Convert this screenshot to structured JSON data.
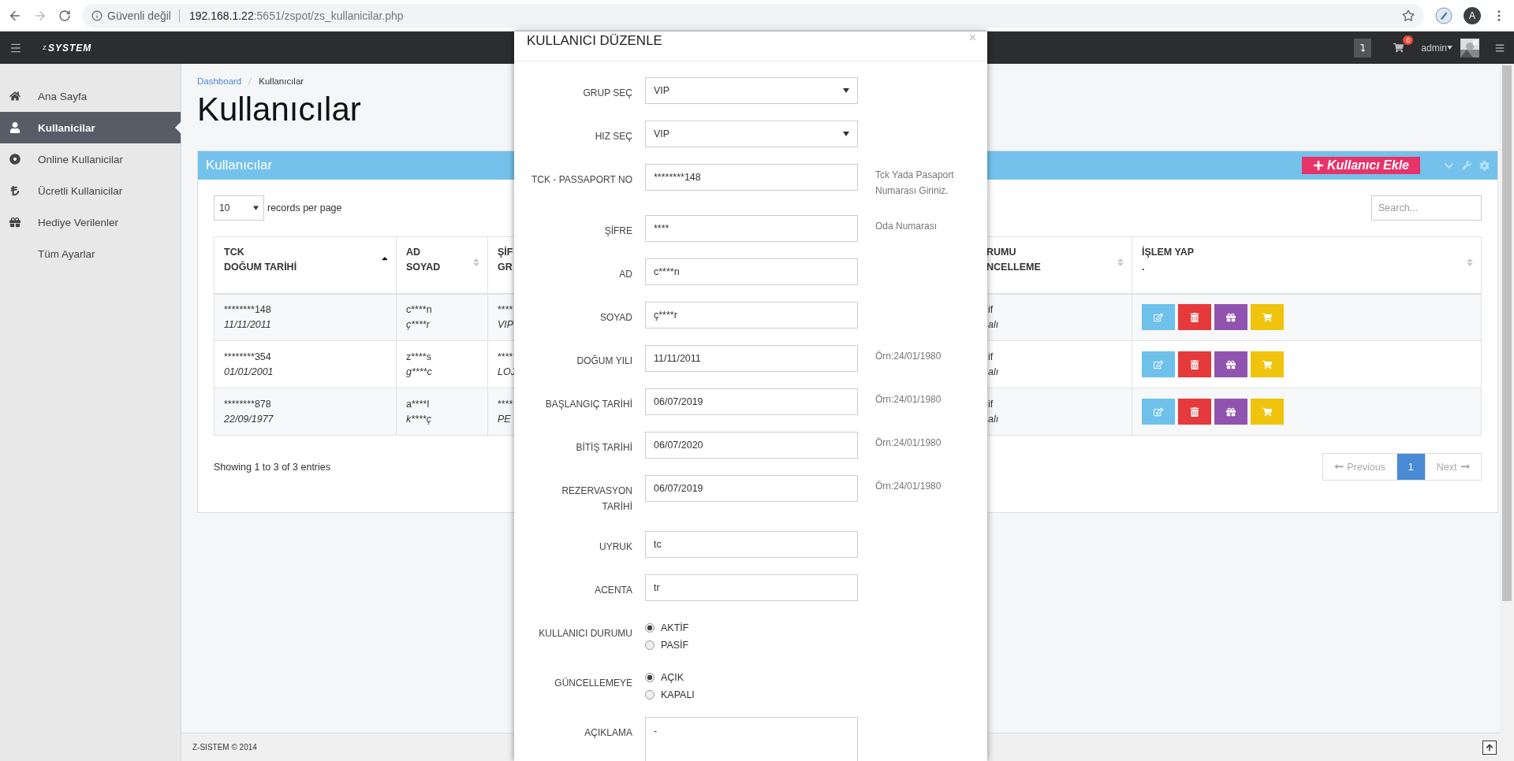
{
  "browser": {
    "security": "Güvenli değil",
    "url_host": "192.168.1.22",
    "url_rest": ":5651/zspot/zs_kullanicilar.php",
    "profile": "A"
  },
  "header": {
    "logo_mark": "Z",
    "logo": "SYSTEM",
    "cart_count": "0",
    "user": "admin"
  },
  "sidebar": {
    "items": [
      {
        "label": "Ana Sayfa",
        "kind": "home",
        "selected": false
      },
      {
        "label": "Kullanicilar",
        "kind": "user",
        "selected": true
      },
      {
        "label": "Online Kullanicilar",
        "kind": "target",
        "selected": false
      },
      {
        "label": "Ücretli Kullanicilar",
        "kind": "lira",
        "selected": false
      },
      {
        "label": "Hediye Verilenler",
        "kind": "gift",
        "selected": false
      },
      {
        "label": "Tüm Ayarlar",
        "kind": "plain",
        "selected": false
      }
    ]
  },
  "breadcrumb": [
    {
      "label": "Dashboard",
      "kind": "link"
    },
    {
      "label": "Kullanıcılar",
      "kind": "current"
    }
  ],
  "page_title": "Kullanıcılar",
  "panel": {
    "title": "Kullanıcılar",
    "add_button": "Kullanıcı Ekle"
  },
  "table_controls": {
    "page_size": "10",
    "page_size_label": "records per page",
    "search_placeholder": "Search..."
  },
  "table": {
    "columns": [
      {
        "lines": [
          "TCK",
          "DOĞUM TARİHİ"
        ],
        "kind": "asc"
      },
      {
        "lines": [
          "AD",
          "SOYAD"
        ],
        "kind": "both"
      },
      {
        "lines": [
          "ŞİF",
          "GR"
        ],
        "kind": "plain"
      },
      {
        "lines": [
          "RUMU",
          "NCELLEME"
        ],
        "kind": "both"
      },
      {
        "lines": [
          "İŞLEM YAP",
          "."
        ],
        "kind": "both"
      }
    ],
    "rows": [
      {
        "cells": [
          [
            "********148",
            "11/11/2011"
          ],
          [
            "c****n",
            "ç****r"
          ],
          [
            "****",
            "VIP"
          ],
          [
            "if",
            "alı"
          ]
        ],
        "actions": [
          {
            "kind": "edit"
          },
          {
            "kind": "delete"
          },
          {
            "kind": "gift"
          },
          {
            "kind": "cart"
          }
        ]
      },
      {
        "cells": [
          [
            "********354",
            "01/01/2001"
          ],
          [
            "z****s",
            "g****c"
          ],
          [
            "****",
            "LOJ"
          ],
          [
            "if",
            "alı"
          ]
        ],
        "actions": [
          {
            "kind": "edit"
          },
          {
            "kind": "delete"
          },
          {
            "kind": "gift"
          },
          {
            "kind": "cart"
          }
        ]
      },
      {
        "cells": [
          [
            "********878",
            "22/09/1977"
          ],
          [
            "a****l",
            "k****ç"
          ],
          [
            "****",
            "PE"
          ],
          [
            "if",
            "alı"
          ]
        ],
        "actions": [
          {
            "kind": "edit"
          },
          {
            "kind": "delete"
          },
          {
            "kind": "gift"
          },
          {
            "kind": "cart"
          }
        ]
      }
    ]
  },
  "summary": "Showing 1 to 3 of 3 entries",
  "pagination": [
    {
      "label": "Previous",
      "kind": "prev",
      "selected": false,
      "disabled": true
    },
    {
      "label": "1",
      "kind": "page",
      "selected": true,
      "disabled": false
    },
    {
      "label": "Next",
      "kind": "next",
      "selected": false,
      "disabled": true
    }
  ],
  "footer": "Z-SISTEM © 2014",
  "modal": {
    "title": "KULLANICI DÜZENLE",
    "close": "×",
    "fields": [
      {
        "label": "GRUP SEÇ",
        "kind": "select",
        "value": "VIP"
      },
      {
        "label": "HIZ SEÇ",
        "kind": "select",
        "value": "VIP"
      },
      {
        "label": "TCK - PASSAPORT NO",
        "kind": "text",
        "value": "********148",
        "help": "Tck Yada Pasaport Numarası Giriniz."
      },
      {
        "label": "ŞİFRE",
        "kind": "text",
        "value": "****",
        "help": "Oda Numarası"
      },
      {
        "label": "AD",
        "kind": "text",
        "value": "c****n"
      },
      {
        "label": "SOYAD",
        "kind": "text",
        "value": "ç****r"
      },
      {
        "label": "DOĞUM YILI",
        "kind": "text",
        "value": "11/11/2011",
        "help": "Örn:24/01/1980"
      },
      {
        "label": "BAŞLANGIÇ TARİHİ",
        "kind": "text",
        "value": "06/07/2019",
        "help": "Örn:24/01/1980"
      },
      {
        "label": "BİTİŞ TARİHİ",
        "kind": "text",
        "value": "06/07/2020",
        "help": "Örn:24/01/1980"
      },
      {
        "label": "REZERVASYON TARİHİ",
        "kind": "text",
        "value": "06/07/2019",
        "help": "Örn:24/01/1980"
      },
      {
        "label": "UYRUK",
        "kind": "text",
        "value": "tc"
      },
      {
        "label": "ACENTA",
        "kind": "text",
        "value": "tr"
      },
      {
        "label": "KULLANICI DURUMU",
        "kind": "radio",
        "options": [
          {
            "label": "AKTİF",
            "selected": true
          },
          {
            "label": "PASİF",
            "selected": false
          }
        ]
      },
      {
        "label": "GÜNCELLEMEYE",
        "kind": "radio",
        "options": [
          {
            "label": "AÇIK",
            "selected": true
          },
          {
            "label": "KAPALI",
            "selected": false
          }
        ]
      },
      {
        "label": "AÇIKLAMA",
        "kind": "textarea",
        "value": "-"
      }
    ]
  }
}
